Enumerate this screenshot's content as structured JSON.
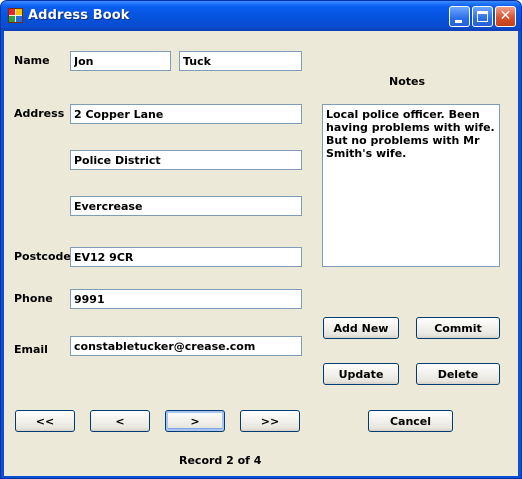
{
  "window": {
    "title": "Address Book",
    "close_glyph": "✕"
  },
  "labels": {
    "name": "Name",
    "address": "Address",
    "postcode": "Postcode",
    "phone": "Phone",
    "email": "Email",
    "notes": "Notes"
  },
  "fields": {
    "first_name": "Jon",
    "last_name": "Tuck",
    "address_line1": "2 Copper Lane",
    "address_line2": "Police District",
    "address_line3": "Evercrease",
    "postcode": "EV12 9CR",
    "phone": "9991",
    "email": "constabletucker@crease.com",
    "notes": "Local police officer. Been having problems with wife. But no problems with Mr Smith's wife."
  },
  "buttons": {
    "add_new": "Add New",
    "commit": "Commit",
    "update": "Update",
    "delete": "Delete",
    "cancel": "Cancel",
    "first": "<<",
    "previous": "<",
    "next": ">",
    "last": ">>"
  },
  "status": {
    "record": "Record 2 of 4"
  },
  "icons": {
    "app": "address-book-icon",
    "minimize": "minimize-icon",
    "maximize": "maximize-icon",
    "close": "close-icon"
  }
}
